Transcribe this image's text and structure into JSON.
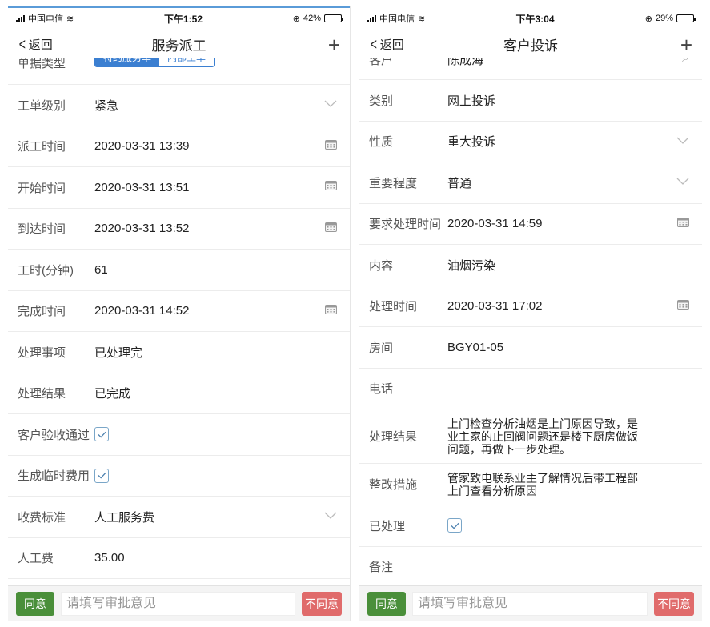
{
  "left": {
    "status": {
      "carrier": "中国电信",
      "time": "下午1:52",
      "battery": "42%",
      "battery_level": 0.42
    },
    "nav": {
      "back": "返回",
      "title": "服务派工",
      "add": "+"
    },
    "top_partial": {
      "label": "单据类型",
      "opt_on": "特约服务单",
      "opt_off": "内部工单"
    },
    "rows": [
      {
        "label": "工单级别",
        "value": "紧急",
        "icon": "chevron-down-icon"
      },
      {
        "label": "派工时间",
        "value": "2020-03-31 13:39",
        "icon": "calendar-icon"
      },
      {
        "label": "开始时间",
        "value": "2020-03-31 13:51",
        "icon": "calendar-icon"
      },
      {
        "label": "到达时间",
        "value": "2020-03-31 13:52",
        "icon": "calendar-icon"
      },
      {
        "label": "工时(分钟)",
        "value": "61",
        "icon": ""
      },
      {
        "label": "完成时间",
        "value": "2020-03-31 14:52",
        "icon": "calendar-icon"
      },
      {
        "label": "处理事项",
        "value": "已处理完",
        "icon": ""
      },
      {
        "label": "处理结果",
        "value": "已完成",
        "icon": ""
      },
      {
        "label": "客户验收通过",
        "value": "",
        "icon": "checkbox-checked"
      },
      {
        "label": "生成临时费用",
        "value": "",
        "icon": "checkbox-checked"
      },
      {
        "label": "收费标准",
        "value": "人工服务费",
        "icon": "chevron-down-icon"
      },
      {
        "label": "人工费",
        "value": "35.00",
        "icon": ""
      }
    ],
    "bottom": {
      "agree": "同意",
      "placeholder": "请填写审批意见",
      "reject": "不同意"
    }
  },
  "right": {
    "status": {
      "carrier": "中国电信",
      "time": "下午3:04",
      "battery": "29%",
      "battery_level": 0.29
    },
    "nav": {
      "back": "返回",
      "title": "客户投诉",
      "add": "+"
    },
    "top_partial": {
      "label": "客户",
      "value": "陈成海"
    },
    "rows": [
      {
        "label": "类别",
        "value": "网上投诉",
        "icon": ""
      },
      {
        "label": "性质",
        "value": "重大投诉",
        "icon": "chevron-down-icon"
      },
      {
        "label": "重要程度",
        "value": "普通",
        "icon": "chevron-down-icon"
      },
      {
        "label": "要求处理时间",
        "value": "2020-03-31 14:59",
        "icon": "calendar-icon"
      },
      {
        "label": "内容",
        "value": "油烟污染",
        "icon": ""
      },
      {
        "label": "处理时间",
        "value": "2020-03-31 17:02",
        "icon": "calendar-icon"
      },
      {
        "label": "房间",
        "value": "BGY01-05",
        "icon": ""
      },
      {
        "label": "电话",
        "value": "",
        "icon": ""
      },
      {
        "label": "处理结果",
        "value": "上门检查分析油烟是上门原因导致，是\n业主家的止回阀问题还是楼下厨房做饭\n问题，再做下一步处理。",
        "icon": "",
        "tall": true
      },
      {
        "label": "整改措施",
        "value": "管家致电联系业主了解情况后带工程部\n上门查看分析原因",
        "icon": ""
      },
      {
        "label": "已处理",
        "value": "",
        "icon": "checkbox-checked"
      },
      {
        "label": "备注",
        "value": "",
        "icon": ""
      }
    ],
    "bottom": {
      "agree": "同意",
      "placeholder": "请填写审批意见",
      "reject": "不同意"
    }
  }
}
